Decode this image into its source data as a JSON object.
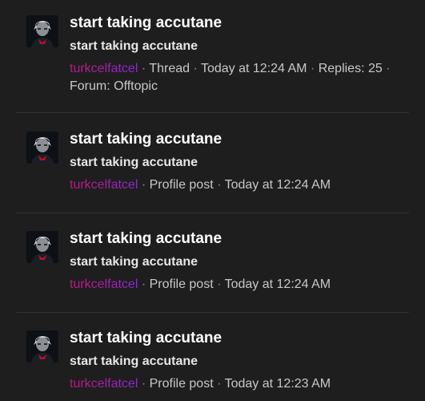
{
  "separator": "·",
  "colors": {
    "background": "#1e1e1e",
    "divider": "#333333",
    "title": "#ffffff",
    "meta_text": "#c8c8c8",
    "username_gradient_start": "#c2187c",
    "username_gradient_end": "#8a2ad6"
  },
  "results": [
    {
      "avatar_icon": "user-avatar-icon",
      "title": "start taking accutane",
      "snippet": "start taking accutane",
      "username": "turkcelfatcel",
      "type": "Thread",
      "time": "Today at 12:24 AM",
      "replies": "Replies: 25",
      "forum": "Forum: Offtopic"
    },
    {
      "avatar_icon": "user-avatar-icon",
      "title": "start taking accutane",
      "snippet": "start taking accutane",
      "username": "turkcelfatcel",
      "type": "Profile post",
      "time": "Today at 12:24 AM"
    },
    {
      "avatar_icon": "user-avatar-icon",
      "title": "start taking accutane",
      "snippet": "start taking accutane",
      "username": "turkcelfatcel",
      "type": "Profile post",
      "time": "Today at 12:24 AM"
    },
    {
      "avatar_icon": "user-avatar-icon",
      "title": "start taking accutane",
      "snippet": "start taking accutane",
      "username": "turkcelfatcel",
      "type": "Profile post",
      "time": "Today at 12:23 AM"
    }
  ]
}
